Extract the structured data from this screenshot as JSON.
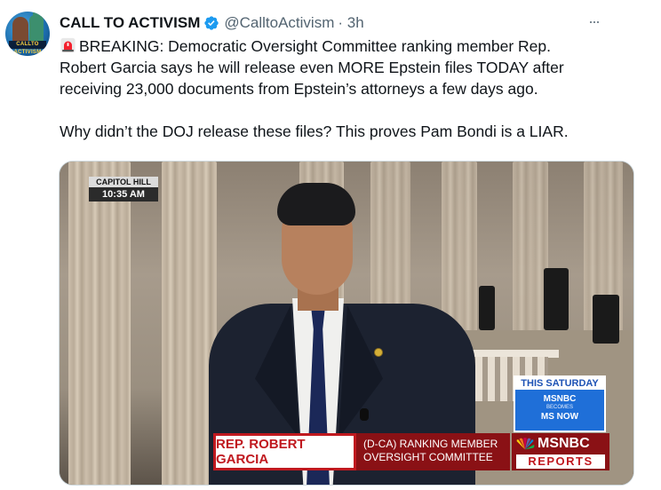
{
  "tweet": {
    "display_name": "CALL TO ACTIVISM",
    "handle": "@CalltoActivism",
    "time": "· 3h",
    "text_line1": "BREAKING: Democratic Oversight Committee ranking member Rep.",
    "text_line2": "Robert Garcia says he will release even MORE Epstein files TODAY after",
    "text_line3": "receiving 23,000 documents from Epstein’s attorneys a few days ago.",
    "text_line4": "Why didn’t the DOJ release these files? This proves Pam Bondi is a LIAR.",
    "icons": {
      "verified": "verified-badge-icon",
      "siren": "rotating-light-icon",
      "more": "more-options-icon"
    },
    "colors": {
      "verified": "#1d9bf0",
      "handle": "#536471",
      "siren": "#f4212e"
    }
  },
  "avatar": {
    "badge_text": "CALLTO ACTIVISM"
  },
  "video": {
    "location": "CAPITOL HILL",
    "clock": "10:35 AM",
    "promo": {
      "header": "THIS SATURDAY",
      "line1": "MSNBC",
      "line2": "BECOMES",
      "line3": "MS NOW"
    },
    "lower_third": {
      "name": "REP. ROBERT GARCIA",
      "title_line1": "(D-CA) RANKING MEMBER",
      "title_line2": "OVERSIGHT COMMITTEE"
    },
    "brand": {
      "network": "MSNBC",
      "show": "REPORTS"
    },
    "colors": {
      "lower_third_red": "#c0191f",
      "lower_third_dark": "#8a1115",
      "promo_blue": "#1f6fd8"
    }
  }
}
